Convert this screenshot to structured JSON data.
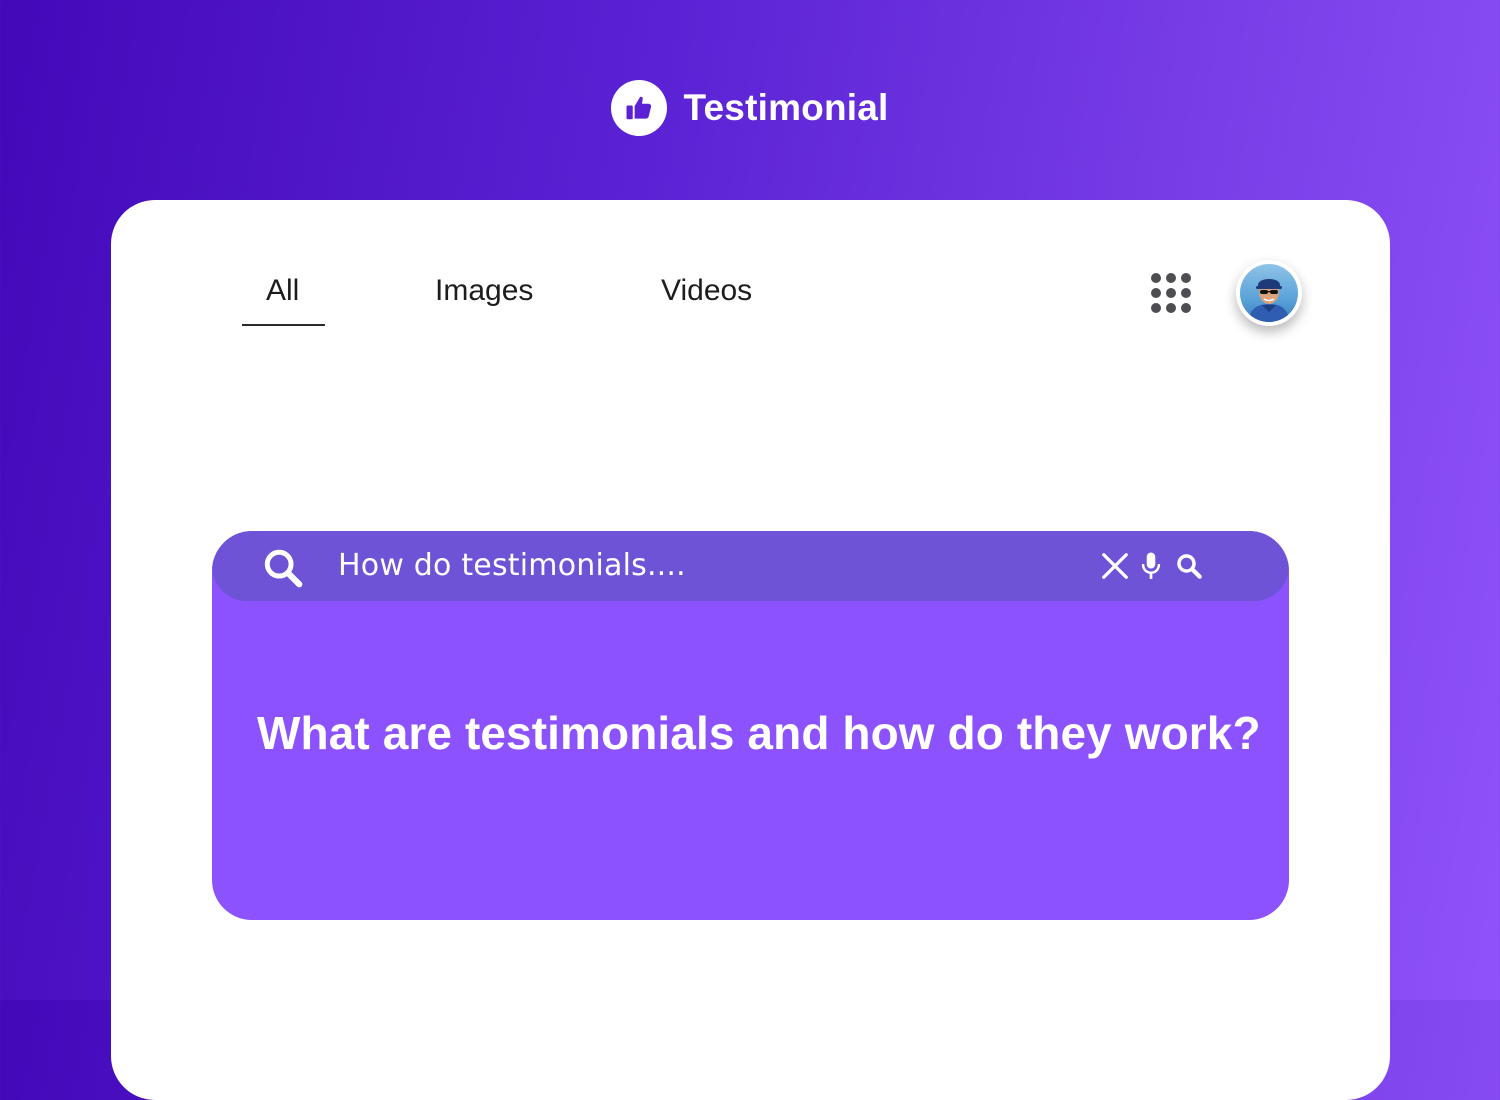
{
  "brand": {
    "name": "Testimonial",
    "logo_icon": "thumbs-up-icon"
  },
  "nav": {
    "tabs": [
      {
        "label": "All",
        "active": true
      },
      {
        "label": "Images",
        "active": false
      },
      {
        "label": "Videos",
        "active": false
      }
    ],
    "apps_icon": "apps-grid-icon",
    "avatar": "user-avatar"
  },
  "search": {
    "query": "How do testimonials....",
    "icons": [
      "search-icon",
      "clear-icon",
      "microphone-icon",
      "search-icon"
    ]
  },
  "result": {
    "headline": "What are testimonials and how do they work?"
  },
  "colors": {
    "background_start": "#4309b9",
    "background_end": "#8f52fb",
    "card": "#ffffff",
    "search_bar": "#6e53d6",
    "result_panel": "#8c52fe"
  }
}
